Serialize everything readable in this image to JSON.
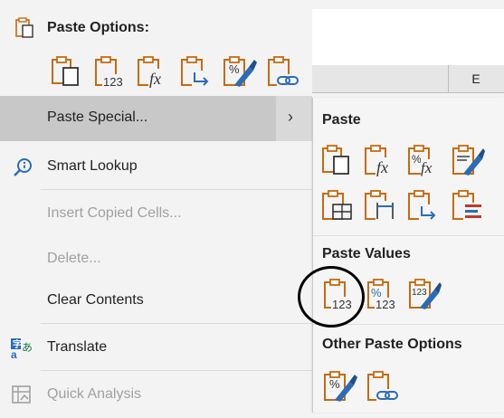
{
  "sheet": {
    "column_label": "E"
  },
  "menu": {
    "paste_options_title": "Paste Options:",
    "items": [
      {
        "id": "paste-special",
        "label": "Paste Special...",
        "arrow": "›"
      },
      {
        "id": "smart-lookup",
        "label": "Smart Lookup"
      },
      {
        "id": "insert-copied-cells",
        "label": "Insert Copied Cells..."
      },
      {
        "id": "delete",
        "label": "Delete..."
      },
      {
        "id": "clear-contents",
        "label": "Clear Contents"
      },
      {
        "id": "translate",
        "label": "Translate"
      },
      {
        "id": "quick-analysis",
        "label": "Quick Analysis"
      }
    ]
  },
  "submenu": {
    "paste_title": "Paste",
    "paste_values_title": "Paste Values",
    "other_title": "Other Paste Options"
  },
  "icon_text": {
    "n123": "123",
    "fx": "fx",
    "pct": "%"
  },
  "colors": {
    "clipboard_orange": "#c66a10",
    "doc_blue": "#2b6cb8",
    "disabled": "#a0a0a0",
    "hover": "#c8c8c8"
  }
}
